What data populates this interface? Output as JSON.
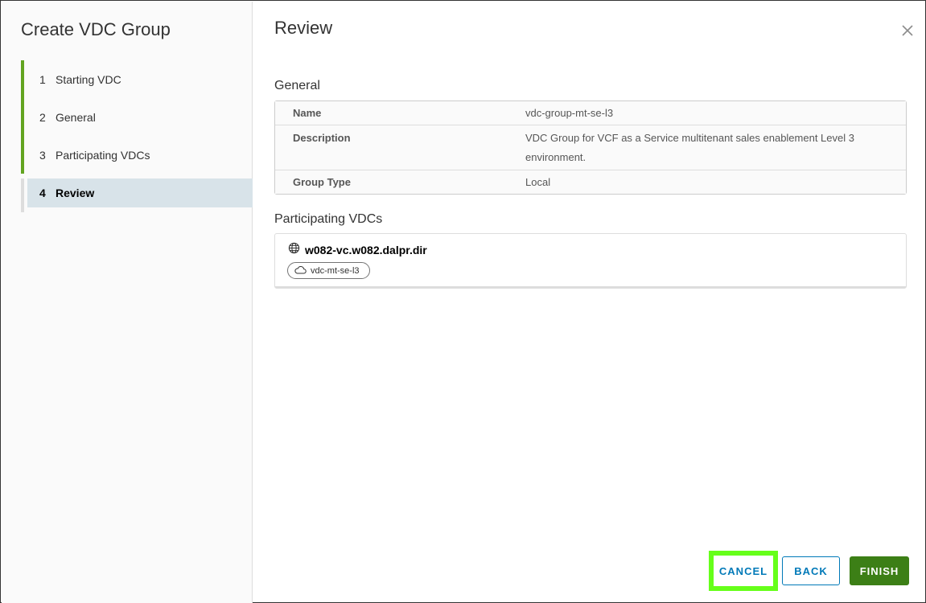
{
  "wizard": {
    "title": "Create VDC Group",
    "steps": [
      {
        "num": "1",
        "label": "Starting VDC"
      },
      {
        "num": "2",
        "label": "General"
      },
      {
        "num": "3",
        "label": "Participating VDCs"
      },
      {
        "num": "4",
        "label": "Review"
      }
    ]
  },
  "page": {
    "title": "Review"
  },
  "general": {
    "title": "General",
    "rows": [
      {
        "key": "Name",
        "value": "vdc-group-mt-se-l3"
      },
      {
        "key": "Description",
        "value": "VDC Group for VCF as a Service multitenant sales enablement Level 3 environment."
      },
      {
        "key": "Group Type",
        "value": "Local"
      }
    ]
  },
  "participating": {
    "title": "Participating VDCs",
    "site_name": "w082-vc.w082.dalpr.dir",
    "vdc_chip": "vdc-mt-se-l3"
  },
  "footer": {
    "cancel_label": "CANCEL",
    "back_label": "BACK",
    "finish_label": "FINISH"
  },
  "colors": {
    "accent_green": "#62a420",
    "finish_button": "#3c7f16",
    "link_blue": "#0079b8",
    "highlight_box": "#66ff1a"
  },
  "icons": {
    "close": "close-icon",
    "site": "globe-icon",
    "vdc": "cloud-icon"
  }
}
